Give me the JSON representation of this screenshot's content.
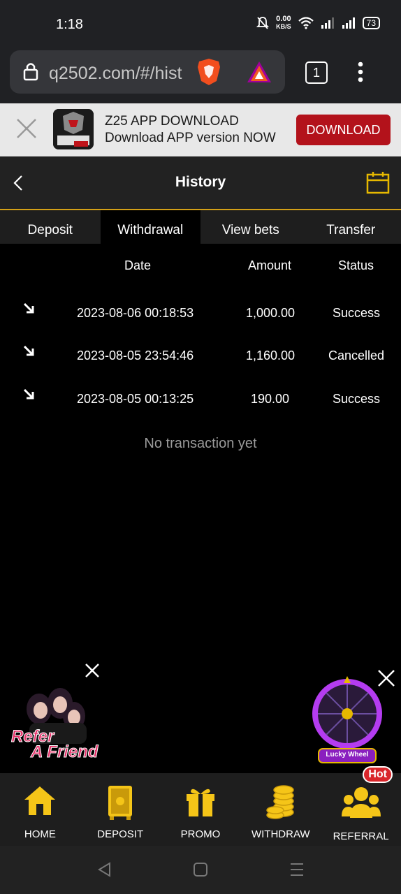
{
  "status_bar": {
    "time": "1:18",
    "net_speed": "0.00",
    "net_unit": "KB/S",
    "battery": "73"
  },
  "browser": {
    "url": "q2502.com/#/hist",
    "tab_count": "1"
  },
  "app_banner": {
    "title": "Z25 APP DOWNLOAD",
    "subtitle": "Download APP version NOW",
    "download_label": "DOWNLOAD",
    "logo_text": "Z25.COM"
  },
  "header": {
    "title": "History"
  },
  "tabs": [
    {
      "label": "Deposit",
      "active": false
    },
    {
      "label": "Withdrawal",
      "active": true
    },
    {
      "label": "View bets",
      "active": false
    },
    {
      "label": "Transfer",
      "active": false
    }
  ],
  "table": {
    "columns": [
      "Date",
      "Amount",
      "Status"
    ],
    "rows": [
      {
        "date": "2023-08-06 00:18:53",
        "amount": "1,000.00",
        "status": "Success"
      },
      {
        "date": "2023-08-05 23:54:46",
        "amount": "1,160.00",
        "status": "Cancelled"
      },
      {
        "date": "2023-08-05 00:13:25",
        "amount": "190.00",
        "status": "Success"
      }
    ],
    "empty_text": "No transaction yet"
  },
  "promos": {
    "refer_line1": "Refer",
    "refer_line2": "A Friend",
    "wheel_label": "Lucky Wheel"
  },
  "bottom_nav": [
    {
      "label": "HOME",
      "icon": "home-icon"
    },
    {
      "label": "DEPOSIT",
      "icon": "safe-icon"
    },
    {
      "label": "PROMO",
      "icon": "gift-icon"
    },
    {
      "label": "WITHDRAW",
      "icon": "coins-icon"
    },
    {
      "label": "REFERRAL",
      "icon": "users-icon",
      "badge": "Hot"
    }
  ],
  "colors": {
    "accent_gold": "#d4a017",
    "download_red": "#b3121b",
    "hot_red": "#d9262b"
  }
}
